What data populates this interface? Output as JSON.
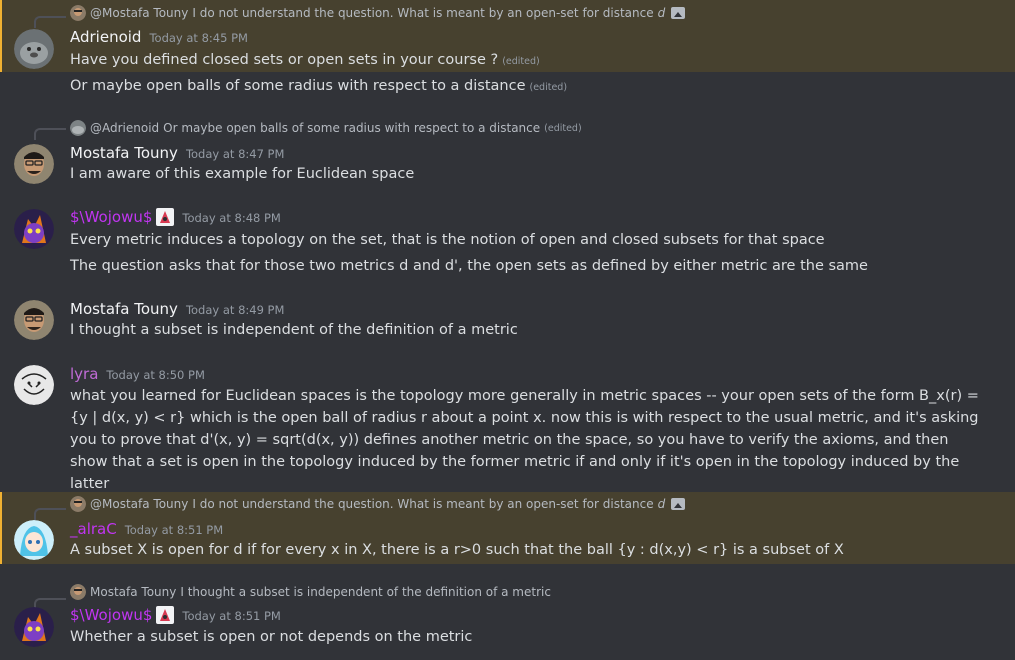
{
  "colors": {
    "background": "#313338",
    "mention_highlight": "#47412f",
    "wojowu_name": "#c135f2",
    "alrac_name": "#c135f2",
    "lyra_name": "#c06bd6",
    "default_name": "#f2f3f5"
  },
  "edited_label": "(edited)",
  "messages": [
    {
      "reply": {
        "author": "@Mostafa Touny",
        "text": "I do not understand the question. What is meant by an open-set for distance",
        "text_tail": "d",
        "icon": "image-icon"
      },
      "author": "Adrienoid",
      "timestamp": "Today at 8:45 PM",
      "lines": [
        "Have you defined closed sets or open sets in your course ?",
        "Or maybe open balls of some radius with respect to a distance"
      ]
    },
    {
      "reply": {
        "author": "@Adrienoid",
        "text": "Or maybe open balls of some radius with respect to a distance",
        "edited": "(edited)"
      },
      "author": "Mostafa Touny",
      "timestamp": "Today at 8:47 PM",
      "lines": [
        "I am aware of this example for Euclidean space"
      ]
    },
    {
      "author": "$\\Wojowu$",
      "timestamp": "Today at 8:48 PM",
      "lines": [
        "Every metric induces a topology on the set, that is the notion of open and closed subsets for that space",
        "The question asks that for those two metrics d and d', the open sets as defined by either metric are the same"
      ]
    },
    {
      "author": "Mostafa Touny",
      "timestamp": "Today at 8:49 PM",
      "lines": [
        "I thought a subset is independent of the definition of a metric"
      ]
    },
    {
      "author": "lyra",
      "timestamp": "Today at 8:50 PM",
      "lines": [
        "what you learned for Euclidean spaces is the topology more generally in metric spaces -- your open sets of the form B_x(r) = {y | d(x, y) < r} which is the open ball of radius r about a point x. now this is with respect to the usual metric, and it's asking you to prove that d'(x, y) = sqrt(d(x, y)) defines another metric on the space, so you have to verify the axioms, and then show that a set is open in the topology induced by the former metric if and only if it's open in the topology induced by the latter"
      ]
    },
    {
      "reply": {
        "author": "@Mostafa Touny",
        "text": "I do not understand the question. What is meant by an open-set for distance",
        "text_tail": "d",
        "icon": "image-icon"
      },
      "author": "_alraC",
      "timestamp": "Today at 8:51 PM",
      "lines": [
        "A subset X is open for d if for every x in X, there is a r>0 such that the ball {y : d(x,y) < r} is a subset of X"
      ]
    },
    {
      "reply": {
        "author": "Mostafa Touny",
        "text": "I thought a subset is independent of the definition of a metric"
      },
      "author": "$\\Wojowu$",
      "timestamp": "Today at 8:51 PM",
      "lines": [
        "Whether a subset is open or not depends on the metric"
      ]
    }
  ]
}
